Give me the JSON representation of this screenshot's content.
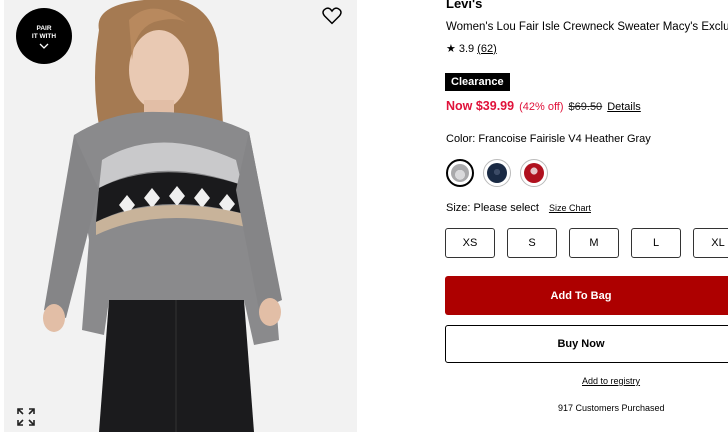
{
  "image": {
    "badge_line1": "PAIR",
    "badge_line2": "IT WITH",
    "favorite_icon": "heart-outline-icon",
    "expand_icon": "expand-icon",
    "sweater_color": "#8a8a8c",
    "skirt_color": "#1b1b1d"
  },
  "product": {
    "brand": "Levi's",
    "title": "Women's Lou Fair Isle Crewneck Sweater Macy's Exclusive",
    "rating": "3.9",
    "review_count": "(62)",
    "badge": "Clearance",
    "price_now": "Now $39.99",
    "discount": "(42% off)",
    "price_was": "$69.50",
    "details_link": "Details",
    "color_label": "Color: Francoise Fairisle V4 Heather Gray",
    "swatches": [
      {
        "name": "Heather Gray",
        "color": "#a9a9ab",
        "selected": true
      },
      {
        "name": "Navy",
        "color": "#1a2a44",
        "selected": false
      },
      {
        "name": "Red",
        "color": "#b0111f",
        "selected": false
      }
    ],
    "size_label": "Size: Please select",
    "size_chart": "Size Chart",
    "sizes": [
      "XS",
      "S",
      "M",
      "L",
      "XL"
    ],
    "add_to_bag": "Add To Bag",
    "buy_now": "Buy Now",
    "registry": "Add to registry",
    "purchased": "917 Customers Purchased"
  },
  "colors": {
    "accent_red": "#ad0000",
    "sale_red": "#e0123a"
  }
}
